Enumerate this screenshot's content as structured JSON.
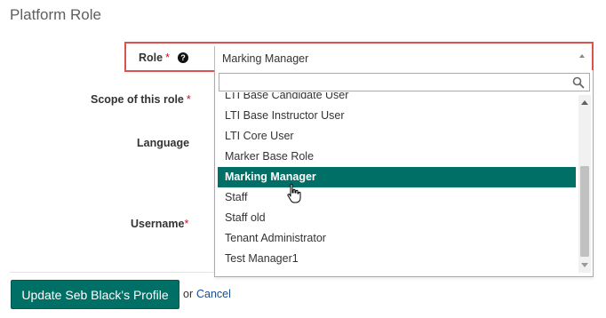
{
  "section_title": "Platform Role",
  "form": {
    "role_label": "Role",
    "scope_label": "Scope of this role",
    "language_label": "Language",
    "username_label": "Username",
    "required_marker": "*",
    "help_glyph": "?"
  },
  "role_select": {
    "selected_value": "Marking Manager",
    "search_value": "",
    "options": [
      "LTI Base Candidate User",
      "LTI Base Instructor User",
      "LTI Core User",
      "Marker Base Role",
      "Marking Manager",
      "Staff",
      "Staff old",
      "Tenant Administrator",
      "Test Manager1"
    ],
    "selected_index": 4
  },
  "footer": {
    "update_button": "Update Seb Black's Profile",
    "or_text": "or",
    "cancel_link": "Cancel"
  },
  "colors": {
    "primary": "#006f65",
    "highlight_border": "#d9534f",
    "required": "#c8102e",
    "link": "#1a4d8f"
  },
  "icons": {
    "help": "question-circle-icon",
    "search": "search-icon",
    "cursor": "hand-pointer-cursor-icon"
  }
}
